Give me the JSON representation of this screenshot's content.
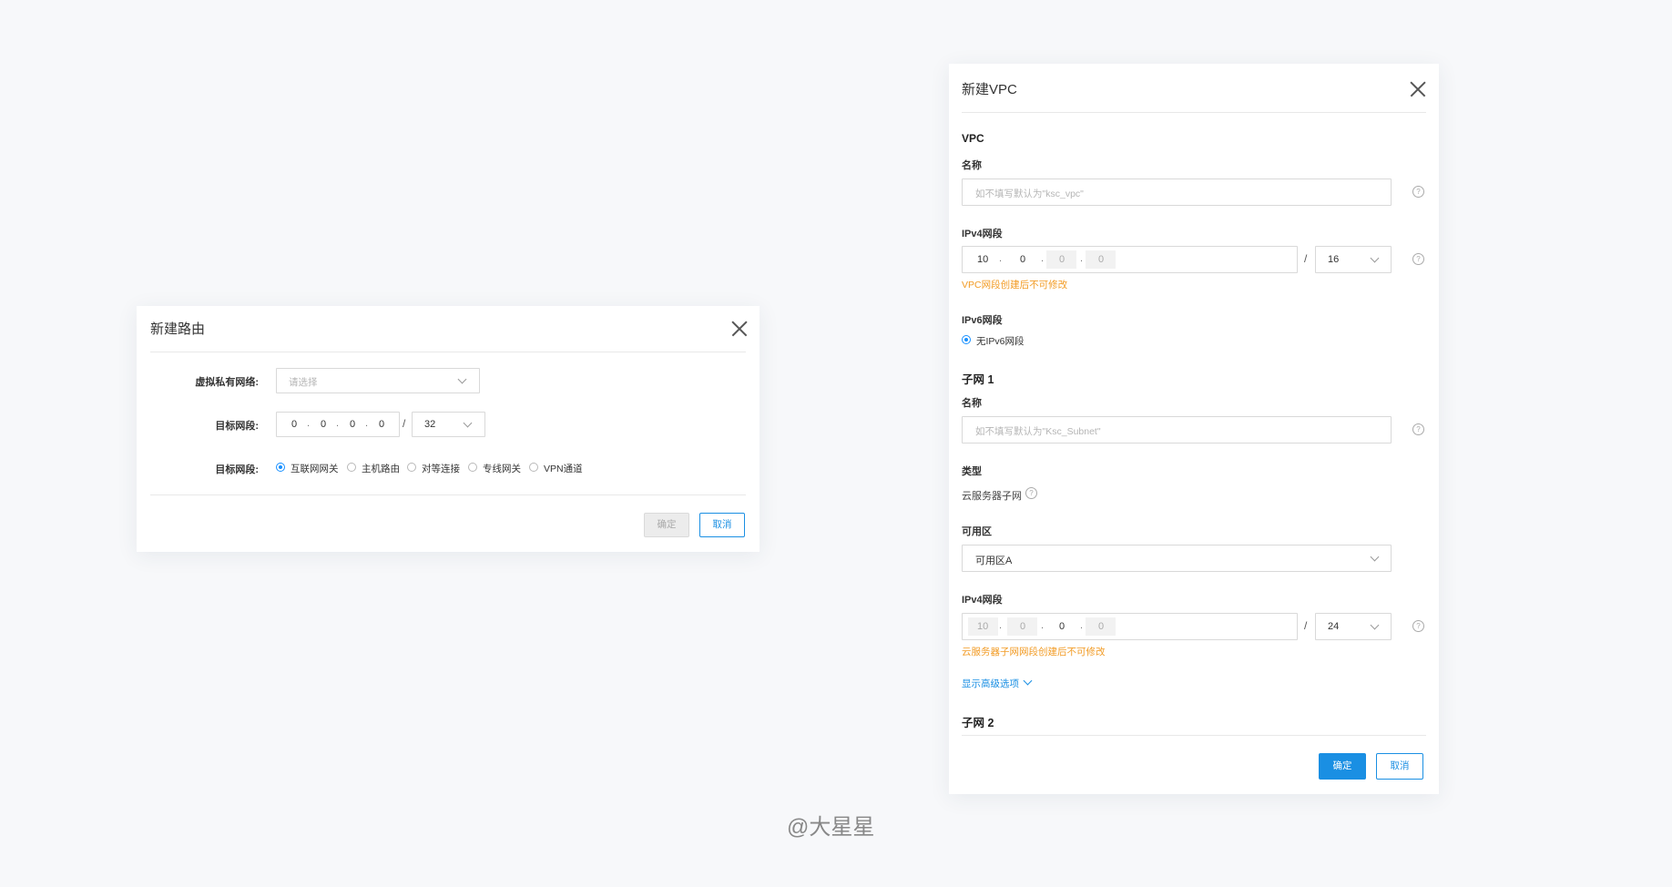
{
  "route_dialog": {
    "title": "新建路由",
    "vpc_label": "虚拟私有网络:",
    "vpc_placeholder": "请选择",
    "target_label": "目标网段:",
    "ip": [
      "0",
      "0",
      "0",
      "0"
    ],
    "mask": "32",
    "next_hop_label": "目标网段:",
    "options": [
      "互联网网关",
      "主机路由",
      "对等连接",
      "专线网关",
      "VPN通道"
    ],
    "selected_option": "互联网网关",
    "ok": "确定",
    "cancel": "取消"
  },
  "vpc_dialog": {
    "title": "新建VPC",
    "vpc_section": "VPC",
    "name_label": "名称",
    "name_placeholder": "如不填写默认为\"ksc_vpc\"",
    "ipv4_label": "IPv4网段",
    "ipv4": [
      "10",
      "0",
      "0",
      "0"
    ],
    "ipv4_mask": "16",
    "ipv4_warning": "VPC网段创建后不可修改",
    "ipv6_label": "IPv6网段",
    "ipv6_option": "无IPv6网段",
    "subnet1_section": "子网 1",
    "subnet_name_label": "名称",
    "subnet_name_placeholder": "如不填写默认为\"Ksc_Subnet\"",
    "type_label": "类型",
    "type_value": "云服务器子网",
    "az_label": "可用区",
    "az_value": "可用区A",
    "subnet_ipv4_label": "IPv4网段",
    "subnet_ipv4": [
      "10",
      "0",
      "0",
      "0"
    ],
    "subnet_mask": "24",
    "subnet_warning": "云服务器子网网段创建后不可修改",
    "advanced_link": "显示高级选项",
    "subnet2_section": "子网 2",
    "ok": "确定",
    "cancel": "取消"
  },
  "watermark": "@大星星",
  "colors": {
    "primary": "#1a8fe3",
    "warning": "#f29b24",
    "background": "#f7f8fa"
  }
}
